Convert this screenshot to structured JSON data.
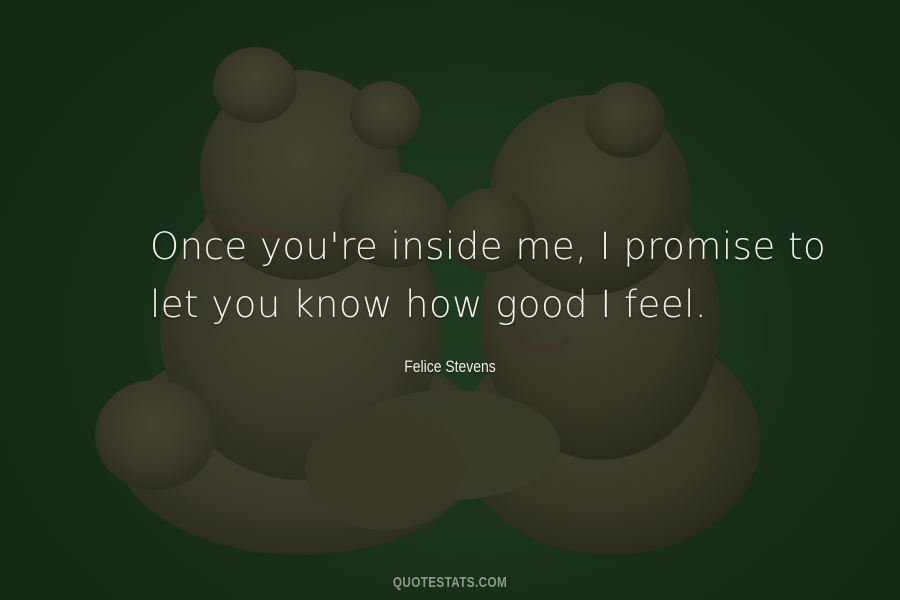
{
  "quote": {
    "lines": [
      "Once you're inside me, I promise to",
      "let you know how good I feel."
    ]
  },
  "author": "Felice Stevens",
  "site": "QUOTESTATS.COM",
  "colors": {
    "background": "#1e3c22",
    "bear": "#4f4a3a",
    "text": "#f1f1ea"
  }
}
